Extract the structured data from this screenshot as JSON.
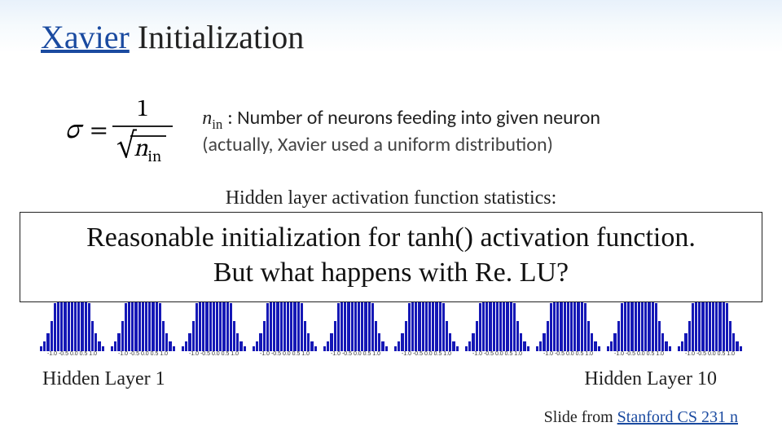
{
  "title": {
    "link_text": "Xavier",
    "rest": " Initialization"
  },
  "formula": {
    "sigma": "σ",
    "equals": "=",
    "numerator": "1",
    "n_label": "n",
    "n_sub": "in"
  },
  "definition": {
    "n_label": "n",
    "n_sub": "in",
    "colon": ": ",
    "line1_rest": "Number of neurons feeding into given neuron",
    "line2": "(actually, Xavier used a uniform distribution)"
  },
  "stats_caption": "Hidden layer activation function statistics:",
  "chart_data": {
    "type": "bar",
    "note": "10 per-layer histograms of hidden-unit activations under Xavier init with tanh; each is roughly bell-shaped over [-1,1]. Peak count scales with layer index (approximate y-axis maxima read from plot).",
    "x_range": [
      -1.0,
      1.0
    ],
    "x_ticks": [
      "-1.0",
      "-0.5",
      "0.0",
      "0.5",
      "1.0"
    ],
    "panels": [
      {
        "layer": 1,
        "y_max": 25000
      },
      {
        "layer": 2,
        "y_max": 30000
      },
      {
        "layer": 3,
        "y_max": 35000
      },
      {
        "layer": 4,
        "y_max": 40000
      },
      {
        "layer": 5,
        "y_max": 45000
      },
      {
        "layer": 6,
        "y_max": 50000
      },
      {
        "layer": 7,
        "y_max": 55000
      },
      {
        "layer": 8,
        "y_max": 60000
      },
      {
        "layer": 9,
        "y_max": 65000
      },
      {
        "layer": 10,
        "y_max": 70000
      }
    ],
    "bell_profile_pct": [
      4,
      8,
      14,
      24,
      38,
      55,
      72,
      86,
      95,
      100,
      95,
      86,
      72,
      55,
      38,
      24,
      14,
      8,
      4
    ]
  },
  "callout": {
    "line1": "Reasonable initialization for tanh() activation function.",
    "line2": "But what happens with Re. LU?"
  },
  "labels": {
    "left": "Hidden Layer 1",
    "right": "Hidden Layer 10"
  },
  "credit": {
    "prefix": "Slide from ",
    "link_text": "Stanford CS 231 n"
  }
}
